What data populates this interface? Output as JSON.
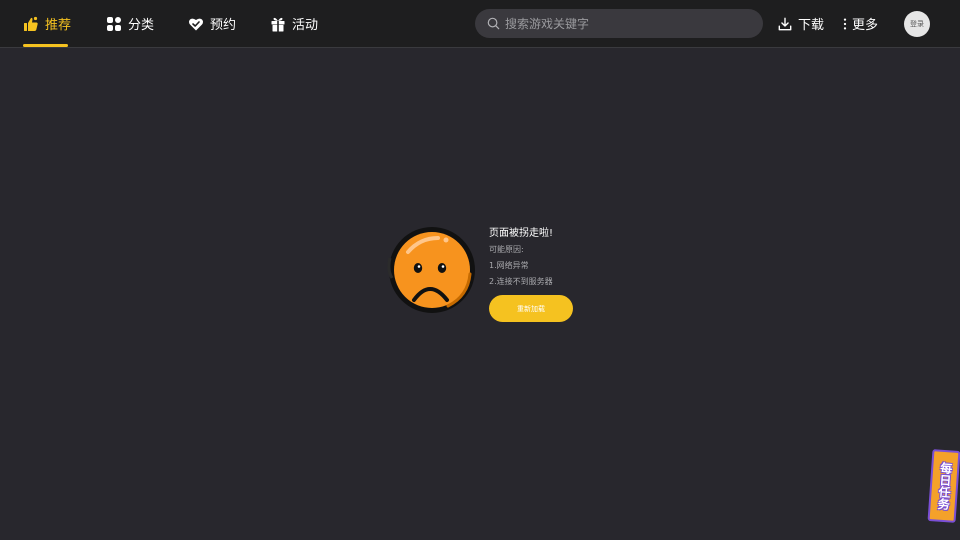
{
  "nav": {
    "items": [
      {
        "label": "推荐",
        "icon": "thumbs-up-icon",
        "active": true
      },
      {
        "label": "分类",
        "icon": "category-grid-icon",
        "active": false
      },
      {
        "label": "预约",
        "icon": "heart-check-icon",
        "active": false
      },
      {
        "label": "活动",
        "icon": "gift-icon",
        "active": false
      }
    ]
  },
  "search": {
    "placeholder": "搜索游戏关键字",
    "value": "",
    "icon": "search-icon"
  },
  "header": {
    "download_label": "下载",
    "download_icon": "download-icon",
    "more_label": "更多",
    "more_icon": "more-vertical-icon",
    "login_label": "登录"
  },
  "error": {
    "title": "页面被拐走啦!",
    "reason_heading": "可能原因:",
    "reasons": [
      "1.网络异常",
      "2.连接不到服务器"
    ],
    "reload_label": "重新加载",
    "icon": "sad-face-icon"
  },
  "daily_task": {
    "label": "每日任务"
  },
  "colors": {
    "accent": "#f5c220",
    "background": "#28272d",
    "topbar": "#1e1e1f",
    "face_orange": "#f7931e"
  }
}
